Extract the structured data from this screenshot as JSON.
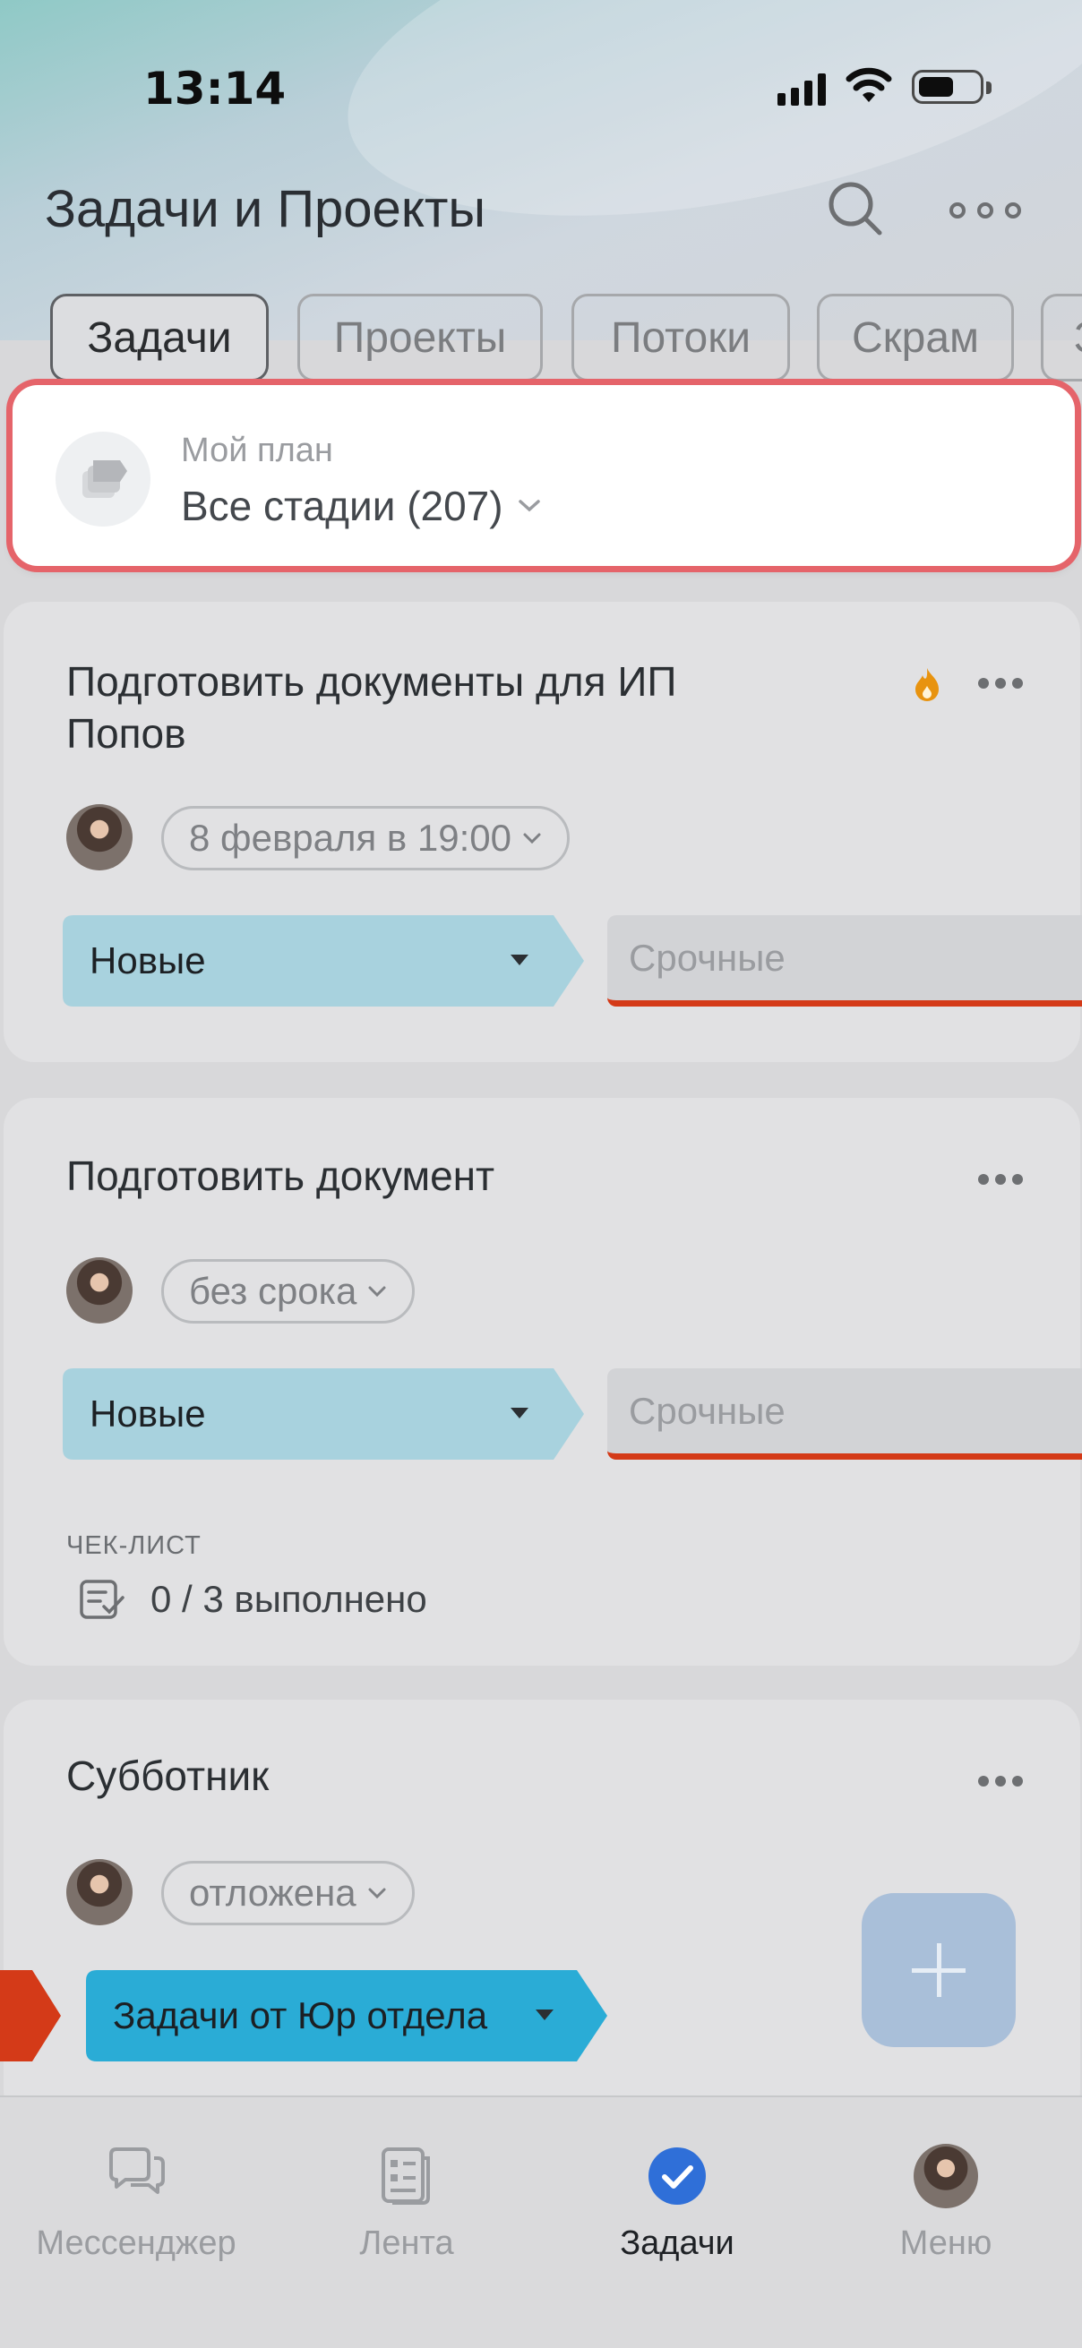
{
  "status_bar": {
    "time": "13:14"
  },
  "header": {
    "title": "Задачи и Проекты"
  },
  "tabs": [
    {
      "label": "Задачи",
      "active": true
    },
    {
      "label": "Проекты",
      "active": false
    },
    {
      "label": "Потоки",
      "active": false
    },
    {
      "label": "Скрам",
      "active": false
    },
    {
      "label": "З",
      "active": false
    }
  ],
  "plan": {
    "label": "Мой план",
    "value": "Все стадии (207)"
  },
  "tasks": [
    {
      "title": "Подготовить документы для ИП Попов",
      "deadline": "8 февраля в 19:00",
      "stage": "Новые",
      "stage_color": "#a8d2de",
      "urgent_label": "Срочные",
      "hot": true
    },
    {
      "title": "Подготовить документ",
      "deadline": "без срока",
      "stage": "Новые",
      "stage_color": "#a8d2de",
      "urgent_label": "Срочные",
      "checklist_label": "ЧЕК-ЛИСТ",
      "checklist_progress": "0 / 3 выполнено"
    },
    {
      "title": "Субботник",
      "deadline": "отложена",
      "stage": "Задачи от Юр отдела",
      "stage_color": "#2aacd6"
    }
  ],
  "tabbar": [
    {
      "label": "Мессенджер",
      "icon": "messenger-icon"
    },
    {
      "label": "Лента",
      "icon": "feed-icon"
    },
    {
      "label": "Задачи",
      "icon": "tasks-check-icon",
      "active": true
    },
    {
      "label": "Меню",
      "icon": "avatar-icon"
    }
  ],
  "colors": {
    "accent": "#2f6fd8",
    "urgent": "#d43a18",
    "highlight": "#e5646a"
  }
}
